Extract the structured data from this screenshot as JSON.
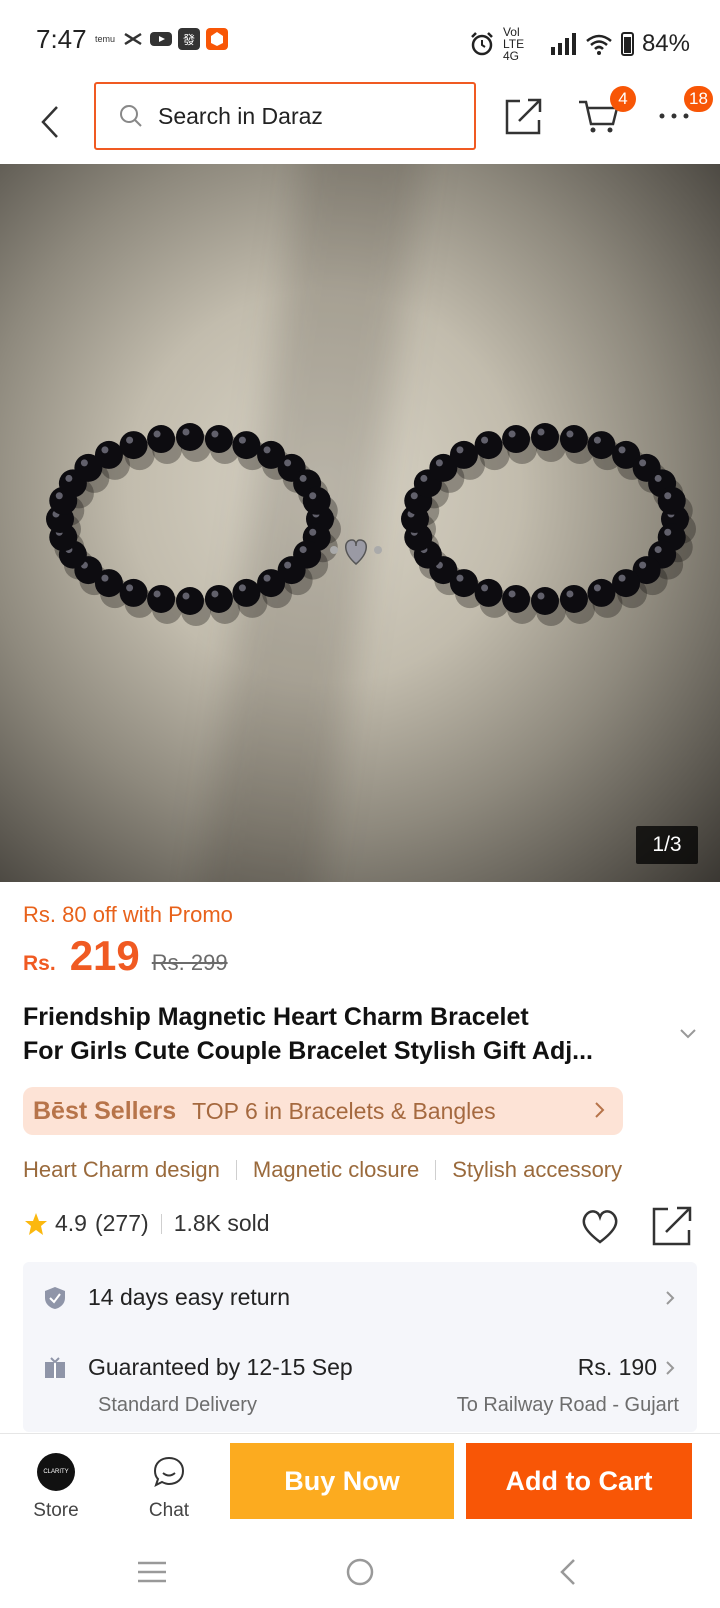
{
  "status_bar": {
    "time": "7:47",
    "left_icons": [
      "temu-icon",
      "tiktok-icon",
      "youtube-icon",
      "app-icon",
      "daraz-icon"
    ],
    "network": "Vol LTE 4G",
    "battery": "84%"
  },
  "header": {
    "search_placeholder": "Search in Daraz",
    "cart_count": "4",
    "more_count": "18"
  },
  "gallery": {
    "counter": "1/3"
  },
  "price": {
    "promo": "Rs. 80 off with Promo",
    "currency": "Rs.",
    "current": "219",
    "original": "Rs. 299"
  },
  "product": {
    "title_line1": "Friendship Magnetic Heart Charm Bracelet",
    "title_line2": "For Girls Cute Couple Bracelet Stylish Gift Adj..."
  },
  "best_sellers": {
    "title": "Bēst Sellers",
    "text": "TOP 6 in Bracelets & Bangles"
  },
  "features": [
    "Heart Charm design",
    "Magnetic closure",
    "Stylish accessory"
  ],
  "rating": {
    "score": "4.9",
    "count": "(277)",
    "sold": "1.8K sold"
  },
  "service": {
    "return_text": "14 days easy return",
    "delivery_text": "Guaranteed by 12-15 Sep",
    "delivery_price": "Rs. 190",
    "delivery_type": "Standard Delivery",
    "delivery_to": "To Railway Road - Gujart"
  },
  "bottom_bar": {
    "store_label": "Store",
    "store_logo_text": "CLARITY",
    "chat_label": "Chat",
    "buy_now": "Buy Now",
    "add_to_cart": "Add to Cart"
  },
  "colors": {
    "accent": "#f85606",
    "buy_now": "#fcab1f",
    "search_border": "#f05a22"
  }
}
